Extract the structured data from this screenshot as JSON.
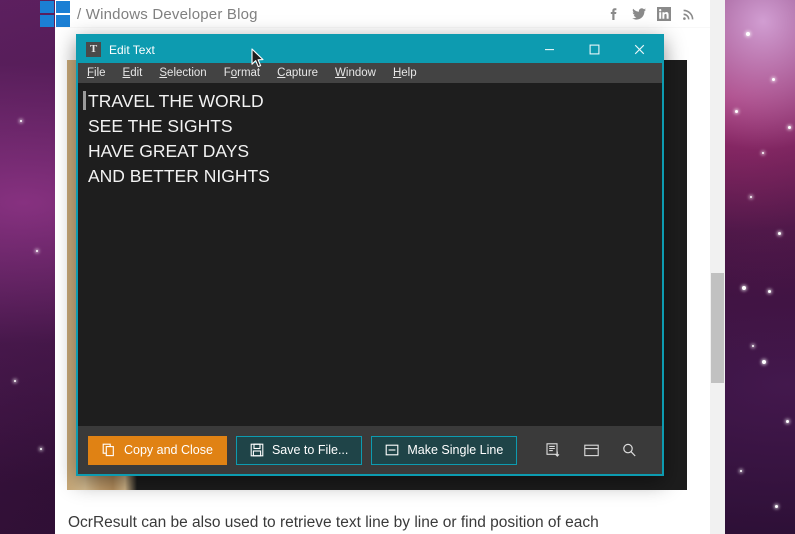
{
  "browser": {
    "breadcrumb": "/ Windows Developer Blog",
    "logo_name": "windows-logo",
    "social": [
      {
        "name": "facebook-icon",
        "label": "f"
      },
      {
        "name": "twitter-icon",
        "label": "twitter"
      },
      {
        "name": "linkedin-icon",
        "label": "in"
      },
      {
        "name": "rss-icon",
        "label": "rss"
      }
    ]
  },
  "dialog": {
    "title": "Edit Text",
    "title_icon": "T",
    "title_icon_name": "text-tool-icon",
    "accent_color": "#0d9bb0",
    "window_controls": [
      {
        "name": "minimize-button",
        "glyph": "minimize"
      },
      {
        "name": "maximize-button",
        "glyph": "maximize"
      },
      {
        "name": "close-button",
        "glyph": "close"
      }
    ],
    "menu": [
      {
        "label": "File",
        "accel": "F"
      },
      {
        "label": "Edit",
        "accel": "E"
      },
      {
        "label": "Selection",
        "accel": "S"
      },
      {
        "label": "Format",
        "accel": "o"
      },
      {
        "label": "Capture",
        "accel": "C"
      },
      {
        "label": "Window",
        "accel": "W"
      },
      {
        "label": "Help",
        "accel": "H"
      }
    ],
    "text_lines": [
      "TRAVEL THE WORLD",
      "SEE THE SIGHTS",
      "HAVE GREAT DAYS",
      "AND BETTER NIGHTS"
    ],
    "buttons": [
      {
        "label": "Copy and Close",
        "icon": "copy-icon",
        "style": "primary",
        "color": "#e08214"
      },
      {
        "label": "Save to File...",
        "icon": "save-disk-icon",
        "style": "secondary",
        "color": "#1f4448"
      },
      {
        "label": "Make Single Line",
        "icon": "single-line-icon",
        "style": "secondary",
        "color": "#1f4448"
      }
    ],
    "icon_buttons": [
      {
        "name": "insert-line-icon"
      },
      {
        "name": "window-layout-icon"
      },
      {
        "name": "search-icon"
      }
    ]
  },
  "article": {
    "paragraph": "OcrResult can be also used to retrieve text line by line or find position of each"
  }
}
